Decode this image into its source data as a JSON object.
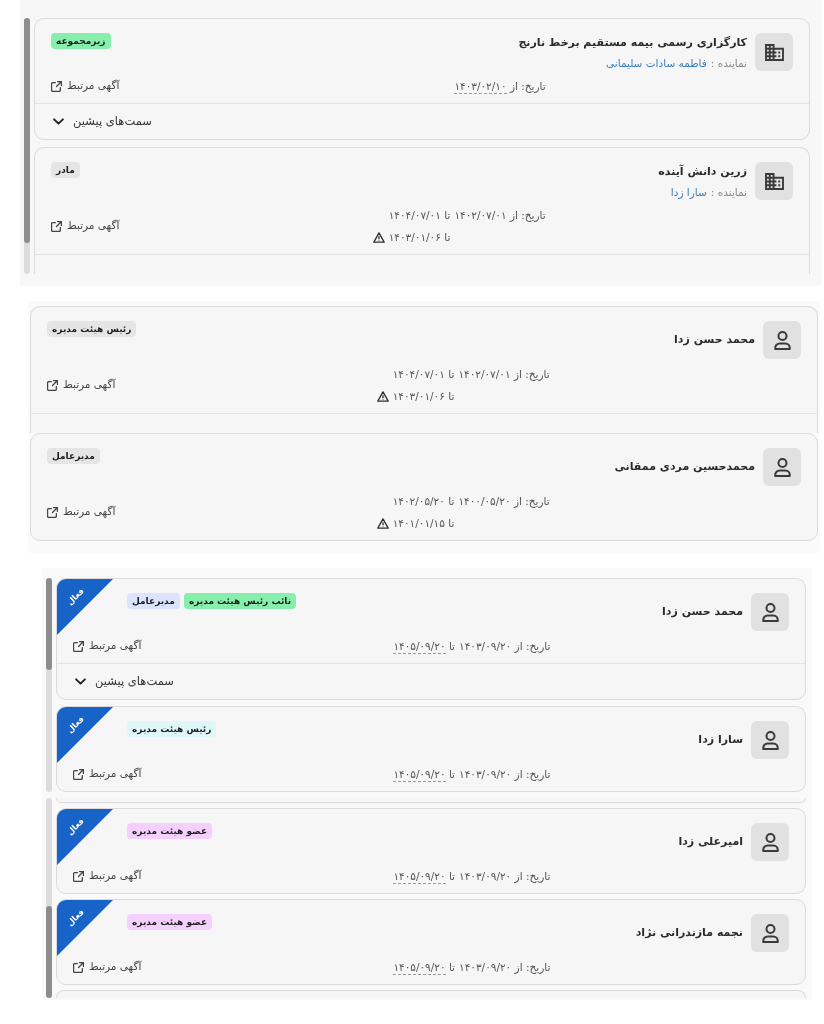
{
  "panels": [
    {
      "scrollbar": {
        "at_end": false
      },
      "cards": [
        {
          "kind": "company",
          "cut_off": false,
          "title": "کارگزاری رسمی بیمه مستقیم برخط نارنج",
          "representative": {
            "label": "نماینده :",
            "name": "فاطمه سادات سلیمانی"
          },
          "badges": [
            {
              "label": "زیرمجموعه",
              "color": "#86efac"
            }
          ],
          "date": {
            "label": "تاریخ: از",
            "from": "۱۴۰۳/۰۲/۱۰",
            "from_underlined": true
          },
          "related_ad": "آگهی مرتبط",
          "history": {
            "label": "سمت‌های پیشین",
            "expanded": false
          }
        },
        {
          "kind": "company",
          "cut_off": true,
          "title": "زرین دانش آینده",
          "representative": {
            "label": "نماینده :",
            "name": "سارا زدا"
          },
          "badges": [
            {
              "label": "مادر",
              "color": "#e5e5e5"
            }
          ],
          "date": {
            "label": "تاریخ: از",
            "from": "۱۴۰۲/۰۷/۰۱",
            "from_underlined": false,
            "to": [
              {
                "label": "تا",
                "value": "۱۴۰۴/۰۷/۰۱",
                "underlined": false,
                "warning": false
              },
              {
                "label": "تا",
                "value": "۱۴۰۳/۰۱/۰۶",
                "underlined": false,
                "warning": true
              }
            ]
          },
          "related_ad": "آگهی مرتبط"
        }
      ]
    },
    {
      "cards": [
        {
          "kind": "person",
          "cut_off": true,
          "title": "محمد حسن زدا",
          "badges": [
            {
              "label": "رئیس هیئت مدیره",
              "color": "#e5e5e5"
            }
          ],
          "date": {
            "label": "تاریخ: از",
            "from": "۱۴۰۲/۰۷/۰۱",
            "from_underlined": false,
            "to": [
              {
                "label": "تا",
                "value": "۱۴۰۴/۰۷/۰۱",
                "underlined": false,
                "warning": false
              },
              {
                "label": "تا",
                "value": "۱۴۰۳/۰۱/۰۶",
                "underlined": false,
                "warning": true
              }
            ]
          },
          "related_ad": "آگهی مرتبط"
        },
        {
          "kind": "person",
          "cut_off": false,
          "title": "محمدحسین مردی ممقانی",
          "badges": [
            {
              "label": "مدیرعامل",
              "color": "#e5e5e5"
            }
          ],
          "date": {
            "label": "تاریخ: از",
            "from": "۱۴۰۰/۰۵/۲۰",
            "from_underlined": false,
            "to": [
              {
                "label": "تا",
                "value": "۱۴۰۲/۰۵/۲۰",
                "underlined": false,
                "warning": false
              },
              {
                "label": "تا",
                "value": "۱۴۰۱/۰۱/۱۵",
                "underlined": false,
                "warning": true
              }
            ]
          },
          "related_ad": "آگهی مرتبط"
        }
      ]
    },
    {
      "scrollbar": {
        "at_end": false
      },
      "cards": [
        {
          "kind": "person",
          "cut_off": false,
          "ribbon": "فعال",
          "title": "محمد حسن زدا",
          "badges": [
            {
              "label": "نائب رئیس هیئت مدیره",
              "color": "#86efac"
            },
            {
              "label": "مدیرعامل",
              "color": "#dbe3fd"
            }
          ],
          "date": {
            "label": "تاریخ: از",
            "from": "۱۴۰۳/۰۹/۲۰",
            "from_underlined": false,
            "to": [
              {
                "label": "تا",
                "value": "۱۴۰۵/۰۹/۲۰",
                "underlined": true,
                "warning": false
              }
            ]
          },
          "related_ad": "آگهی مرتبط",
          "history": {
            "label": "سمت‌های پیشین",
            "expanded": false
          }
        },
        {
          "kind": "person",
          "cut_off": false,
          "ribbon": "فعال",
          "title": "سارا زدا",
          "badges": [
            {
              "label": "رئیس هیئت مدیره",
              "color": "#e0f7fa"
            }
          ],
          "date": {
            "label": "تاریخ: از",
            "from": "۱۴۰۳/۰۹/۲۰",
            "from_underlined": false,
            "to": [
              {
                "label": "تا",
                "value": "۱۴۰۵/۰۹/۲۰",
                "underlined": true,
                "warning": false
              }
            ]
          },
          "related_ad": "آگهی مرتبط"
        }
      ]
    },
    {
      "scrollbar": {
        "at_end": true
      },
      "edge_above": true,
      "edge_below": true,
      "cards": [
        {
          "kind": "person",
          "cut_off": false,
          "ribbon": "فعال",
          "title": "امیرعلی زدا",
          "badges": [
            {
              "label": "عضو هیئت مدیره",
              "color": "#f5d0fe"
            }
          ],
          "date": {
            "label": "تاریخ: از",
            "from": "۱۴۰۳/۰۹/۲۰",
            "from_underlined": false,
            "to": [
              {
                "label": "تا",
                "value": "۱۴۰۵/۰۹/۲۰",
                "underlined": true,
                "warning": false
              }
            ]
          },
          "related_ad": "آگهی مرتبط"
        },
        {
          "kind": "person",
          "cut_off": false,
          "ribbon": "فعال",
          "title": "نجمه مازندرانی نژاد",
          "badges": [
            {
              "label": "عضو هیئت مدیره",
              "color": "#f5d0fe"
            }
          ],
          "date": {
            "label": "تاریخ: از",
            "from": "۱۴۰۳/۰۹/۲۰",
            "from_underlined": false,
            "to": [
              {
                "label": "تا",
                "value": "۱۴۰۵/۰۹/۲۰",
                "underlined": true,
                "warning": false
              }
            ]
          },
          "related_ad": "آگهی مرتبط"
        }
      ]
    }
  ]
}
